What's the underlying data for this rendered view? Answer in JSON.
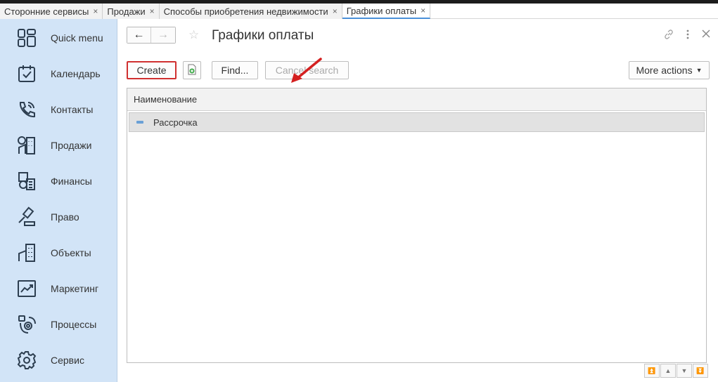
{
  "tabs": [
    {
      "label": "Сторонние сервисы",
      "active": false
    },
    {
      "label": "Продажи",
      "active": false
    },
    {
      "label": "Способы приобретения недвижимости",
      "active": false
    },
    {
      "label": "Графики оплаты",
      "active": true
    }
  ],
  "tab_close_glyph": "×",
  "sidebar": {
    "items": [
      {
        "label": "Quick menu",
        "icon": "quick-menu-icon"
      },
      {
        "label": "Календарь",
        "icon": "calendar-icon"
      },
      {
        "label": "Контакты",
        "icon": "contacts-icon"
      },
      {
        "label": "Продажи",
        "icon": "sales-icon"
      },
      {
        "label": "Финансы",
        "icon": "finance-icon"
      },
      {
        "label": "Право",
        "icon": "law-icon"
      },
      {
        "label": "Объекты",
        "icon": "buildings-icon"
      },
      {
        "label": "Маркетинг",
        "icon": "chart-icon"
      },
      {
        "label": "Процессы",
        "icon": "process-icon"
      },
      {
        "label": "Сервис",
        "icon": "gear-icon"
      }
    ]
  },
  "header": {
    "title": "Графики оплаты",
    "back_glyph": "←",
    "forward_glyph": "→",
    "star_glyph": "☆"
  },
  "toolbar": {
    "create_label": "Create",
    "find_label": "Find...",
    "cancel_search_label": "Cancel search",
    "more_actions_label": "More actions"
  },
  "grid": {
    "columns": [
      "Наименование"
    ],
    "rows": [
      {
        "name": "Рассрочка"
      }
    ]
  },
  "colors": {
    "sidebar_bg": "#d2e4f7",
    "icon_color": "#2d3e50",
    "highlight_red": "#d03030",
    "accent_blue": "#4a90d9"
  }
}
